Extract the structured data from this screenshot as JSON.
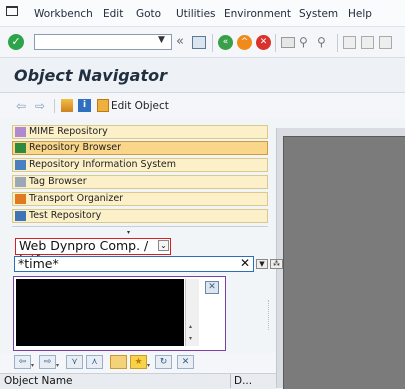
{
  "menu": {
    "items": [
      {
        "label": "Workbench"
      },
      {
        "label": "Edit"
      },
      {
        "label": "Goto"
      },
      {
        "label": "Utilities"
      },
      {
        "label": "Environment"
      },
      {
        "label": "System"
      },
      {
        "label": "Help"
      }
    ]
  },
  "toolbar": {
    "command_value": "",
    "icons": [
      "enter-icon",
      "back-arrows-icon",
      "save-icon",
      "back-icon",
      "exit-icon",
      "cancel-icon",
      "print-icon",
      "find-icon",
      "find-next-icon",
      "first-page-icon",
      "previous-page-icon"
    ]
  },
  "page": {
    "title": "Object Navigator"
  },
  "app_toolbar": {
    "edit_object_label": "Edit Object"
  },
  "navigator": {
    "items": [
      {
        "label": "MIME Repository",
        "icon": "mime-icon"
      },
      {
        "label": "Repository Browser",
        "icon": "repository-browser-icon",
        "selected": true
      },
      {
        "label": "Repository Information System",
        "icon": "info-system-icon"
      },
      {
        "label": "Tag Browser",
        "icon": "tag-icon"
      },
      {
        "label": "Transport Organizer",
        "icon": "transport-icon"
      },
      {
        "label": "Test Repository",
        "icon": "test-icon"
      }
    ]
  },
  "selection": {
    "object_type": "Web Dynpro Comp. / Intf.",
    "search_value": "*time*"
  },
  "list": {
    "columns": [
      {
        "label": "Object Name"
      },
      {
        "label": "D..."
      }
    ]
  },
  "colors": {
    "selected_row": "#f9d68a",
    "row": "#fbf0c8",
    "type_border": "#d62020",
    "search_border": "#2c6fb7",
    "list_border": "#7d3fa3"
  }
}
